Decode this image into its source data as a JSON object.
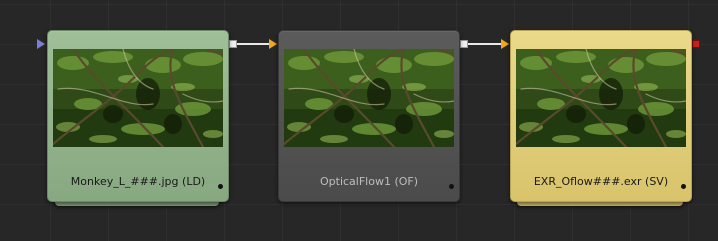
{
  "flow": {
    "nodes": [
      {
        "id": "loader",
        "label": "Monkey_L_###.jpg  (LD)",
        "color": "#9fbf98",
        "thumbnail": "jungle-frame"
      },
      {
        "id": "opticalflow",
        "label": "OpticalFlow1  (OF)",
        "color": "#555555",
        "thumbnail": "jungle-frame"
      },
      {
        "id": "saver",
        "label": "EXR_Oflow###.exr  (SV)",
        "color": "#e6d47f",
        "thumbnail": "jungle-frame"
      }
    ],
    "connection_color": "#e9e9e9",
    "input_arrow_color": "#f2a81c",
    "saver_output_color": "#d01e1e",
    "icons": {
      "left_input": "triangle-right-icon",
      "tray_dots": "view-indicator-dots-icon"
    }
  }
}
